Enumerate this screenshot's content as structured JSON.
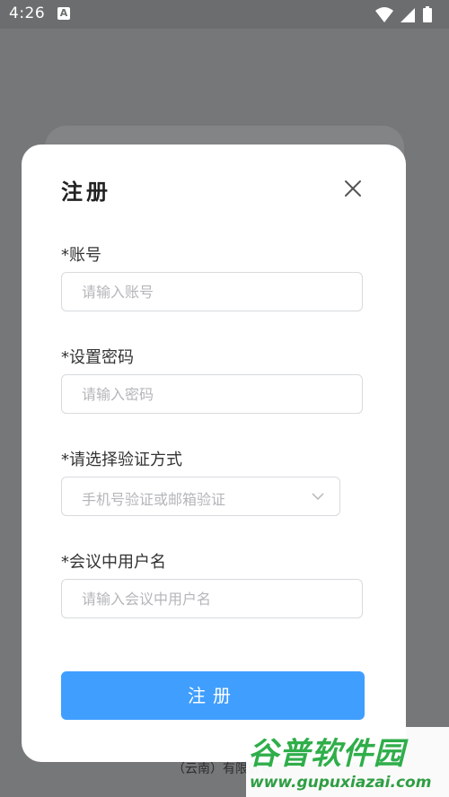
{
  "status_bar": {
    "time": "4:26",
    "notification_letter": "A"
  },
  "background": {
    "company_text": "（云南）有限公司"
  },
  "watermark": {
    "title": "谷普软件园",
    "url": "www.gupuxiazai.com"
  },
  "modal": {
    "title": "注册",
    "close_icon": "close-icon",
    "fields": {
      "account": {
        "label": "*账号",
        "placeholder": "请输入账号"
      },
      "password": {
        "label": "*设置密码",
        "placeholder": "请输入密码"
      },
      "verification": {
        "label": "*请选择验证方式",
        "placeholder": "手机号验证或邮箱验证"
      },
      "meeting_username": {
        "label": "*会议中用户名",
        "placeholder": "请输入会议中用户名"
      }
    },
    "submit_label": "注册"
  },
  "colors": {
    "accent": "#409eff",
    "overlay": "#757778",
    "watermark_green": "#2fae4a"
  }
}
